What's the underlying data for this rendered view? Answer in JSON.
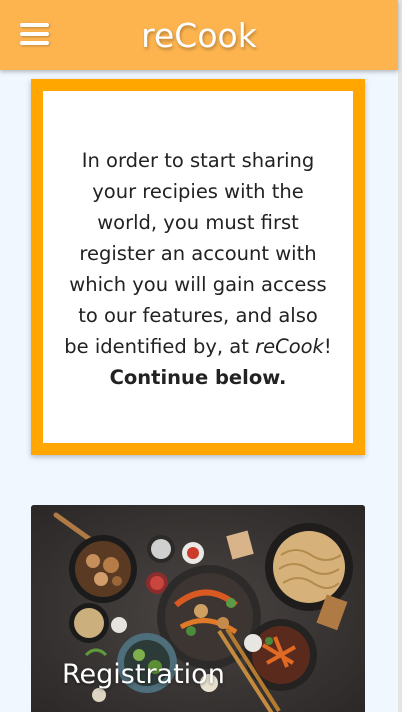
{
  "header": {
    "title": "reCook",
    "background": "#fdb44f"
  },
  "info": {
    "text_main": "In order to start sharing your recipies with the world, you must first register an account with which you will gain access to our features, and also be identified by, at",
    "brand": "reCook",
    "exclaim": "!",
    "continue": "Continue below.",
    "border_color": "#ffa600"
  },
  "registration": {
    "label": "Registration"
  }
}
